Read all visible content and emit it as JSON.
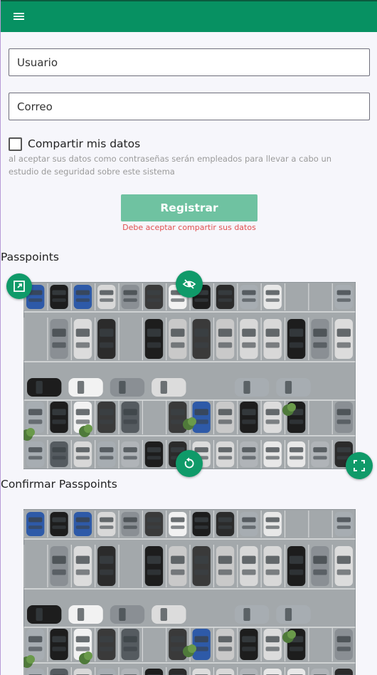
{
  "header": {
    "menu_icon": "menu-icon",
    "color": "#079162"
  },
  "form": {
    "username_placeholder": "Usuario",
    "email_placeholder": "Correo",
    "share_data_label": "Compartir mis datos",
    "share_data_checked": false,
    "hint": "al aceptar sus datos como contraseñas serán empleados para llevar a cabo un estudio de seguridad sobre este sistema",
    "register_label": "Registrar",
    "error_text": "Debe aceptar compartir sus datos"
  },
  "passpoints": {
    "title": "Passpoints",
    "image_subject": "parking lot with cars (aerial view)",
    "actions": [
      "open-in-new-icon",
      "eye-off-icon",
      "reset-icon",
      "fullscreen-icon"
    ]
  },
  "confirm": {
    "title": "Confirmar Passpoints"
  }
}
